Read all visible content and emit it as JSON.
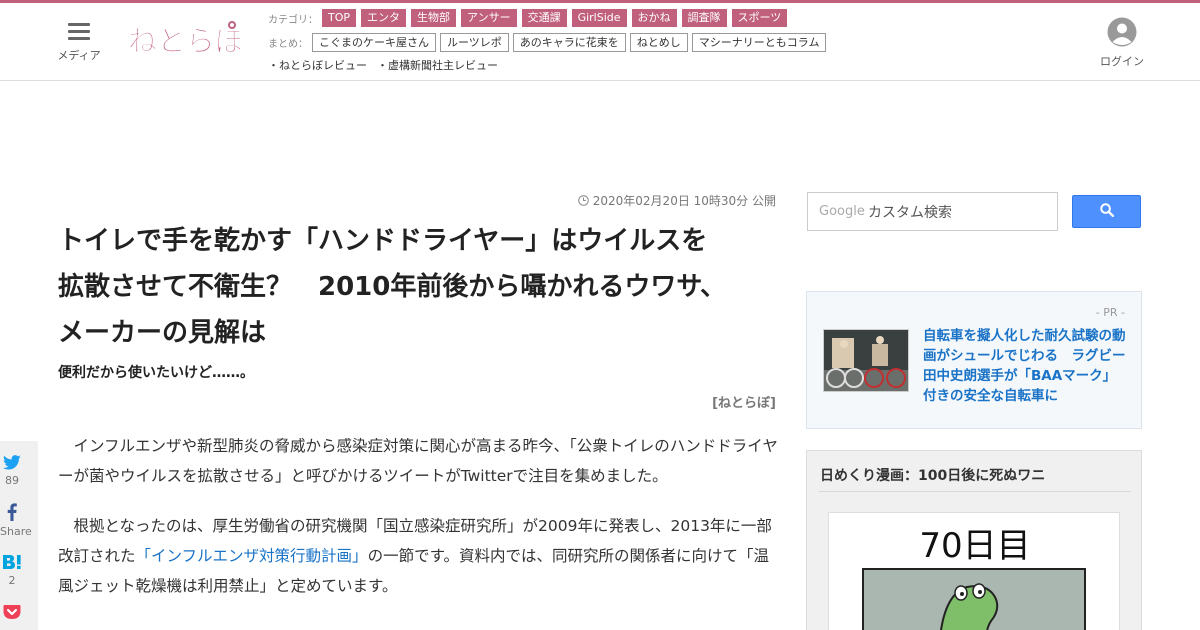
{
  "header": {
    "menu_label": "メディア",
    "logo_text": "ねとらぼ",
    "categories_label": "カテゴリ：",
    "categories": [
      "TOP",
      "エンタ",
      "生物部",
      "アンサー",
      "交通課",
      "GirlSide",
      "おかね",
      "調査隊",
      "スポーツ"
    ],
    "summaries_label": "まとめ：",
    "summaries": [
      "こぐまのケーキ屋さん",
      "ルーツレポ",
      "あのキャラに花束を",
      "ねとめし",
      "マシーナリーともコラム"
    ],
    "reviews": [
      "・ねとらぼレビュー",
      "・虚構新聞社主レビュー"
    ],
    "login_label": "ログイン"
  },
  "article": {
    "published": "2020年02月20日 10時30分 公開",
    "title_line1": "トイレで手を乾かす「ハンドドライヤー」はウイルスを",
    "title_line2": "拡散させて不衛生？　2010年前後から囁かれるウワサ、",
    "title_line3": "メーカーの見解は",
    "subtitle": "便利だから使いたいけど……。",
    "source": "[ねとらぼ]",
    "para1": "　インフルエンザや新型肺炎の脅威から感染症対策に関心が高まる昨今、「公衆トイレのハンドドライヤーが菌やウイルスを拡散させる」と呼びかけるツイートがTwitterで注目を集めました。",
    "para2_before": "　根拠となったのは、厚生労働省の研究機関「国立感染症研究所」が2009年に発表し、2013年に一部改訂された",
    "para2_link": "「インフルエンザ対策行動計画」",
    "para2_after": "の一節です。資料内では、同研究所の関係者に向けて「温風ジェット乾燥機は利用禁止」と定めています。"
  },
  "share": {
    "twitter_count": "89",
    "facebook_label": "Share",
    "hatena_count": "2"
  },
  "sidebar": {
    "search_brand": "Google",
    "search_placeholder": "カスタム検索",
    "pr_label": "- PR -",
    "pr_text": "自転車を擬人化した耐久試験の動画がシュールでじわる　ラグビー田中史朗選手が「BAAマーク」付きの安全な自転車に",
    "manga_title": "日めくり漫画：100日後に死ぬワニ",
    "manga_day": "70日目"
  },
  "colors": {
    "brand": "#c0607d",
    "link": "#1a73c7",
    "search_button": "#4d90fe",
    "twitter": "#1da1f2",
    "facebook": "#3b5998",
    "hatena": "#00a4de",
    "pocket": "#ee4056"
  }
}
